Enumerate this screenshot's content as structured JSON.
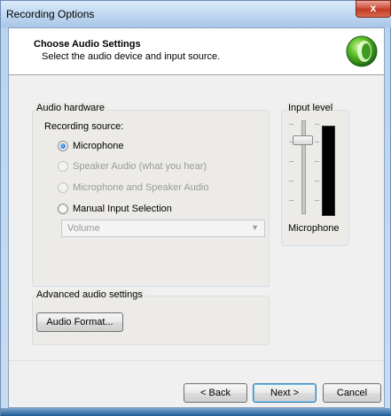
{
  "window": {
    "title": "Recording Options",
    "close_label": "x"
  },
  "header": {
    "title": "Choose Audio Settings",
    "subtitle": "Select the audio device and input source.",
    "logo_icon": "green-orb-logo-icon"
  },
  "audio_hardware": {
    "group_label": "Audio hardware",
    "recording_source_label": "Recording source:",
    "options": [
      {
        "label": "Microphone",
        "checked": true,
        "enabled": true
      },
      {
        "label": "Speaker Audio (what you hear)",
        "checked": false,
        "enabled": false
      },
      {
        "label": "Microphone and Speaker Audio",
        "checked": false,
        "enabled": false
      },
      {
        "label": "Manual Input Selection",
        "checked": false,
        "enabled": true
      }
    ],
    "input_select": {
      "value": "Volume",
      "enabled": false
    }
  },
  "input_level": {
    "group_label": "Input level",
    "device_label": "Microphone",
    "level": 0
  },
  "advanced": {
    "group_label": "Advanced audio settings",
    "audio_format_button": "Audio Format..."
  },
  "footer": {
    "back_button": "< Back",
    "next_button": "Next >",
    "cancel_button": "Cancel"
  },
  "colors": {
    "accent_green": "#3cd03c",
    "close_red": "#c23b26",
    "disabled_text": "#9a9a9a"
  }
}
